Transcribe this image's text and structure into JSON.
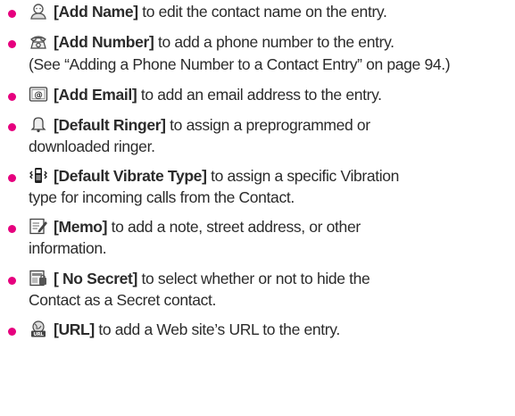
{
  "accent_color": "#e6007e",
  "items": [
    {
      "icon": "person-head-icon",
      "key": "[Add Name]",
      "text": " to edit the contact name on the entry.",
      "cont": ""
    },
    {
      "icon": "telephone-icon",
      "key": "[Add Number]",
      "text": " to add a phone number to the entry.",
      "cont": "(See “Adding a Phone Number to a Contact Entry” on page 94.)"
    },
    {
      "icon": "email-at-icon",
      "key": "[Add Email]",
      "text": " to add an email address to the entry.",
      "cont": ""
    },
    {
      "icon": "bell-icon",
      "key": "[Default Ringer]",
      "text": " to assign a preprogrammed or",
      "cont": "downloaded ringer."
    },
    {
      "icon": "vibrate-phone-icon",
      "key": "[Default Vibrate Type]",
      "text": " to assign a specific Vibration",
      "cont": "type for incoming calls from the Contact."
    },
    {
      "icon": "memo-pencil-icon",
      "key": "[Memo]",
      "text": " to add a note, street address, or other",
      "cont": "information."
    },
    {
      "icon": "secret-contact-icon",
      "key": "[ No Secret]",
      "text": " to select whether or not to hide the",
      "cont": "Contact as a Secret contact."
    },
    {
      "icon": "url-globe-icon",
      "key": "[URL]",
      "text": " to add a Web site’s URL to the entry.",
      "cont": ""
    }
  ]
}
